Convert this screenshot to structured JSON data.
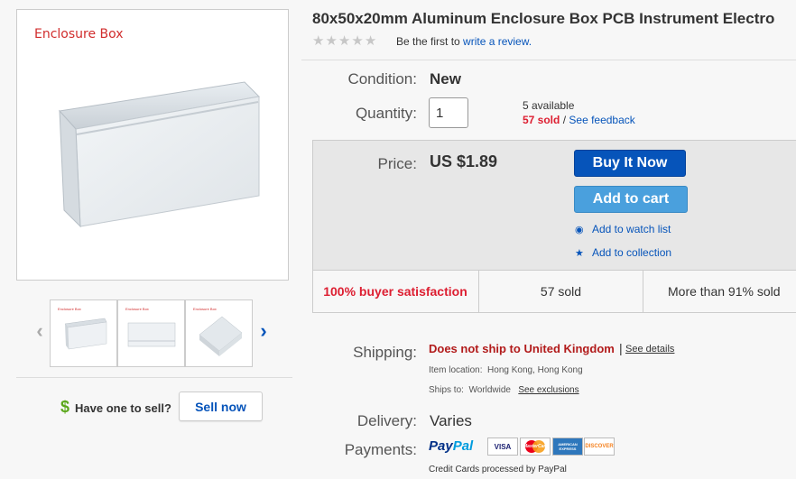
{
  "product": {
    "title": "80x50x20mm Aluminum Enclosure Box PCB Instrument Electro",
    "image_label": "Enclosure Box",
    "thumbnail_label": "Enclosure Box"
  },
  "rating": {
    "stars": 5,
    "text_prefix": "Be the first to",
    "link": "write a review."
  },
  "condition": {
    "label": "Condition:",
    "value": "New"
  },
  "quantity": {
    "label": "Quantity:",
    "value": "1",
    "available": "5 available",
    "sold": "57 sold",
    "separator": "/",
    "feedback_link": "See feedback"
  },
  "price": {
    "label": "Price:",
    "value": "US $1.89",
    "buy_now": "Buy It Now",
    "add_to_cart": "Add to cart",
    "watch_list": "Add to watch list",
    "collection": "Add to collection"
  },
  "stats": {
    "satisfaction": "100% buyer satisfaction",
    "sold": "57 sold",
    "more_than": "More than 91% sold"
  },
  "shipping": {
    "label": "Shipping:",
    "status": "Does not ship to United Kingdom",
    "separator": "|",
    "details_link": "See details",
    "location_label": "Item location:",
    "location": "Hong Kong, Hong Kong",
    "ships_to_label": "Ships to:",
    "ships_to": "Worldwide",
    "exclusions_link": "See exclusions"
  },
  "delivery": {
    "label": "Delivery:",
    "value": "Varies"
  },
  "payments": {
    "label": "Payments:",
    "paypal_pay": "Pay",
    "paypal_pal": "Pal",
    "cards": [
      "VISA",
      "MasterCard",
      "AMERICAN EXPRESS",
      "DISCOVER"
    ],
    "note": "Credit Cards processed by PayPal"
  },
  "sell": {
    "symbol": "$",
    "text": "Have one to sell?",
    "button": "Sell now"
  },
  "nav": {
    "prev": "‹",
    "next": "›"
  },
  "colors": {
    "accent": "#0654ba",
    "cart": "#4aa0dd",
    "alert_red": "#dd1e31",
    "sell_green": "#5ba71b"
  }
}
